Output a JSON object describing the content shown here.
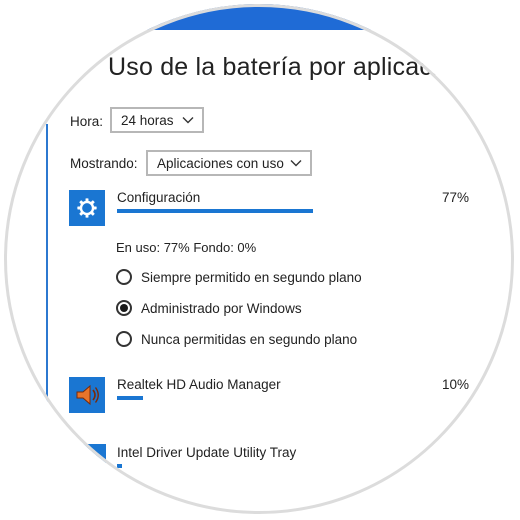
{
  "page": {
    "title": "Uso de la batería por aplicacio"
  },
  "filters": {
    "time_label": "Hora:",
    "time_value": "24 horas",
    "showing_label": "Mostrando:",
    "showing_value": "Aplicaciones con uso"
  },
  "apps": [
    {
      "name": "Configuración",
      "percent": "77%",
      "usage_fraction": 0.77,
      "icon": "gear-icon",
      "details": {
        "usage_text": "En uso: 77%  Fondo: 0%",
        "options": [
          {
            "label": "Siempre permitido en segundo plano",
            "selected": false
          },
          {
            "label": "Administrado por Windows",
            "selected": true
          },
          {
            "label": "Nunca permitidas en segundo plano",
            "selected": false
          }
        ]
      }
    },
    {
      "name": "Realtek HD Audio Manager",
      "percent": "10%",
      "usage_fraction": 0.1,
      "icon": "speaker-icon"
    },
    {
      "name": "Intel Driver Update Utility Tray",
      "usage_fraction": 0.02,
      "icon": "app-icon"
    }
  ],
  "colors": {
    "accent": "#1a76d2",
    "top_bar": "#1f6bd6",
    "ring": "#dcdcdc"
  }
}
